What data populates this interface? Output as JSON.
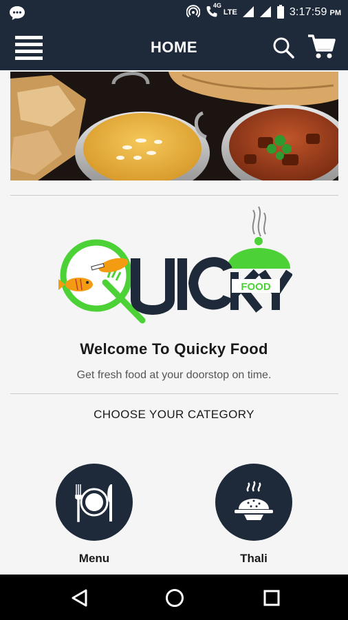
{
  "status_bar": {
    "network": "4G",
    "lte": "LTE",
    "time": "3:17:59",
    "ampm": "PM"
  },
  "app_bar": {
    "title": "HOME",
    "icons": [
      "menu-icon",
      "search-icon",
      "cart-icon"
    ]
  },
  "banner": {
    "icon": "food-banner-image"
  },
  "logo": {
    "wordmark": "QUICKY",
    "tagline": "FOOD",
    "colors": {
      "green": "#4cd137",
      "navy": "#1e2a3a",
      "orange": "#f39c12"
    }
  },
  "welcome": {
    "title": "Welcome To Quicky Food",
    "subtitle": "Get fresh food at your doorstop on time."
  },
  "categories": {
    "heading": "CHOOSE YOUR CATEGORY",
    "items": [
      {
        "label": "Menu",
        "icon": "plate-cutlery-icon"
      },
      {
        "label": "Thali",
        "icon": "thali-dish-icon"
      }
    ]
  },
  "nav_bar": {
    "icons": [
      "back-icon",
      "home-icon",
      "recents-icon"
    ]
  },
  "colors": {
    "primary": "#1e2a3a",
    "background": "#f5f5f5",
    "accent": "#4cd137"
  }
}
